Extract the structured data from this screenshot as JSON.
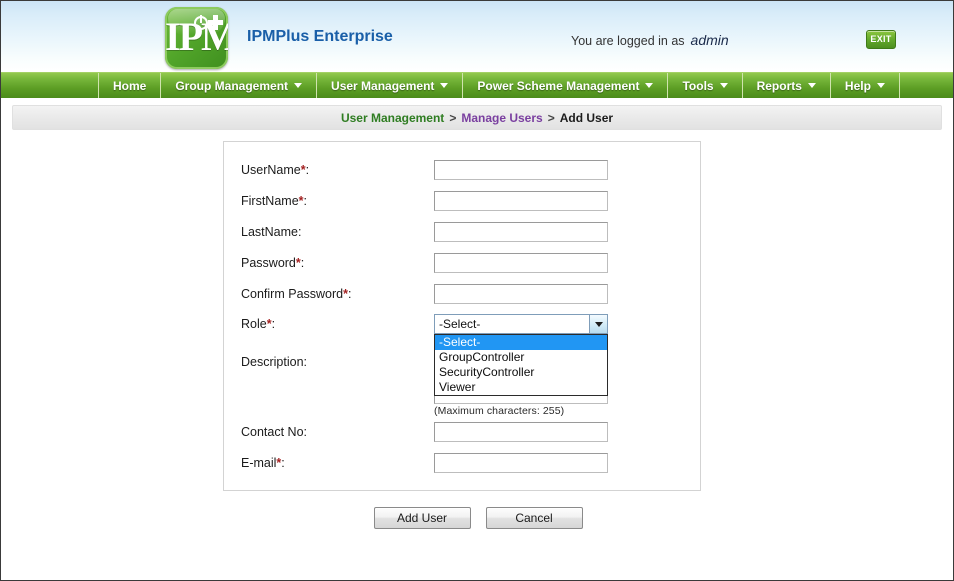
{
  "header": {
    "logo_text": "IPM",
    "app_title": "IPMPlus Enterprise",
    "login_prefix": "You are logged in as",
    "login_user": "admin",
    "exit_label": "EXIT"
  },
  "nav": {
    "items": [
      {
        "label": "Home",
        "caret": false
      },
      {
        "label": "Group Management",
        "caret": true
      },
      {
        "label": "User Management",
        "caret": true
      },
      {
        "label": "Power Scheme Management",
        "caret": true
      },
      {
        "label": "Tools",
        "caret": true
      },
      {
        "label": "Reports",
        "caret": true
      },
      {
        "label": "Help",
        "caret": true
      }
    ]
  },
  "breadcrumb": {
    "first": "User Management",
    "sep1": ">",
    "second": "Manage Users",
    "sep2": ">",
    "third": "Add User"
  },
  "form": {
    "fields": {
      "username_label": "UserName",
      "username_value": "",
      "firstname_label": "FirstName",
      "firstname_value": "",
      "lastname_label": "LastName:",
      "lastname_value": "",
      "password_label": "Password",
      "password_value": "",
      "confirm_label": "Confirm Password",
      "confirm_value": "",
      "role_label": "Role",
      "description_label": "Description:",
      "description_value": "",
      "description_hint": "(Maximum characters: 255)",
      "contact_label": "Contact No:",
      "contact_value": "",
      "email_label": "E-mail",
      "email_value": ""
    },
    "role_select": {
      "value": "-Select-",
      "expanded": true,
      "options": [
        "-Select-",
        "GroupController",
        "SecurityController",
        "Viewer"
      ],
      "selected_index": 0
    },
    "required_marker": "*",
    "colon": ":"
  },
  "actions": {
    "submit_label": "Add User",
    "cancel_label": "Cancel"
  },
  "colors": {
    "nav_green": "#5d9e25",
    "crumb_green": "#2f7d22",
    "crumb_purple": "#7a3fa0",
    "title_blue": "#1a5fa8",
    "required_red": "#a32020",
    "highlight_blue": "#2196f3"
  }
}
